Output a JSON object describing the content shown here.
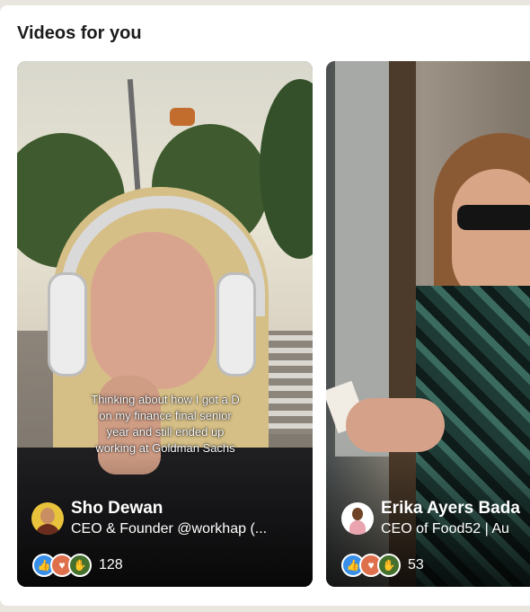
{
  "section": {
    "title": "Videos for you"
  },
  "videos": [
    {
      "caption": [
        "Thinking about how I got a D",
        "on my finance final senior",
        "year and still ended up",
        "working at Goldman Sachs"
      ],
      "author_name": "Sho Dewan",
      "author_title": "CEO & Founder @workhap (...",
      "reaction_icons": [
        "like-icon",
        "love-icon",
        "celebrate-icon"
      ],
      "reaction_count": "128"
    },
    {
      "author_name": "Erika Ayers Bada",
      "author_title": "CEO of Food52 | Au",
      "reaction_icons": [
        "like-icon",
        "love-icon",
        "celebrate-icon"
      ],
      "reaction_count": "53"
    }
  ],
  "colors": {
    "like": "#378fe9",
    "love": "#df704d",
    "celebrate": "#44712e"
  }
}
